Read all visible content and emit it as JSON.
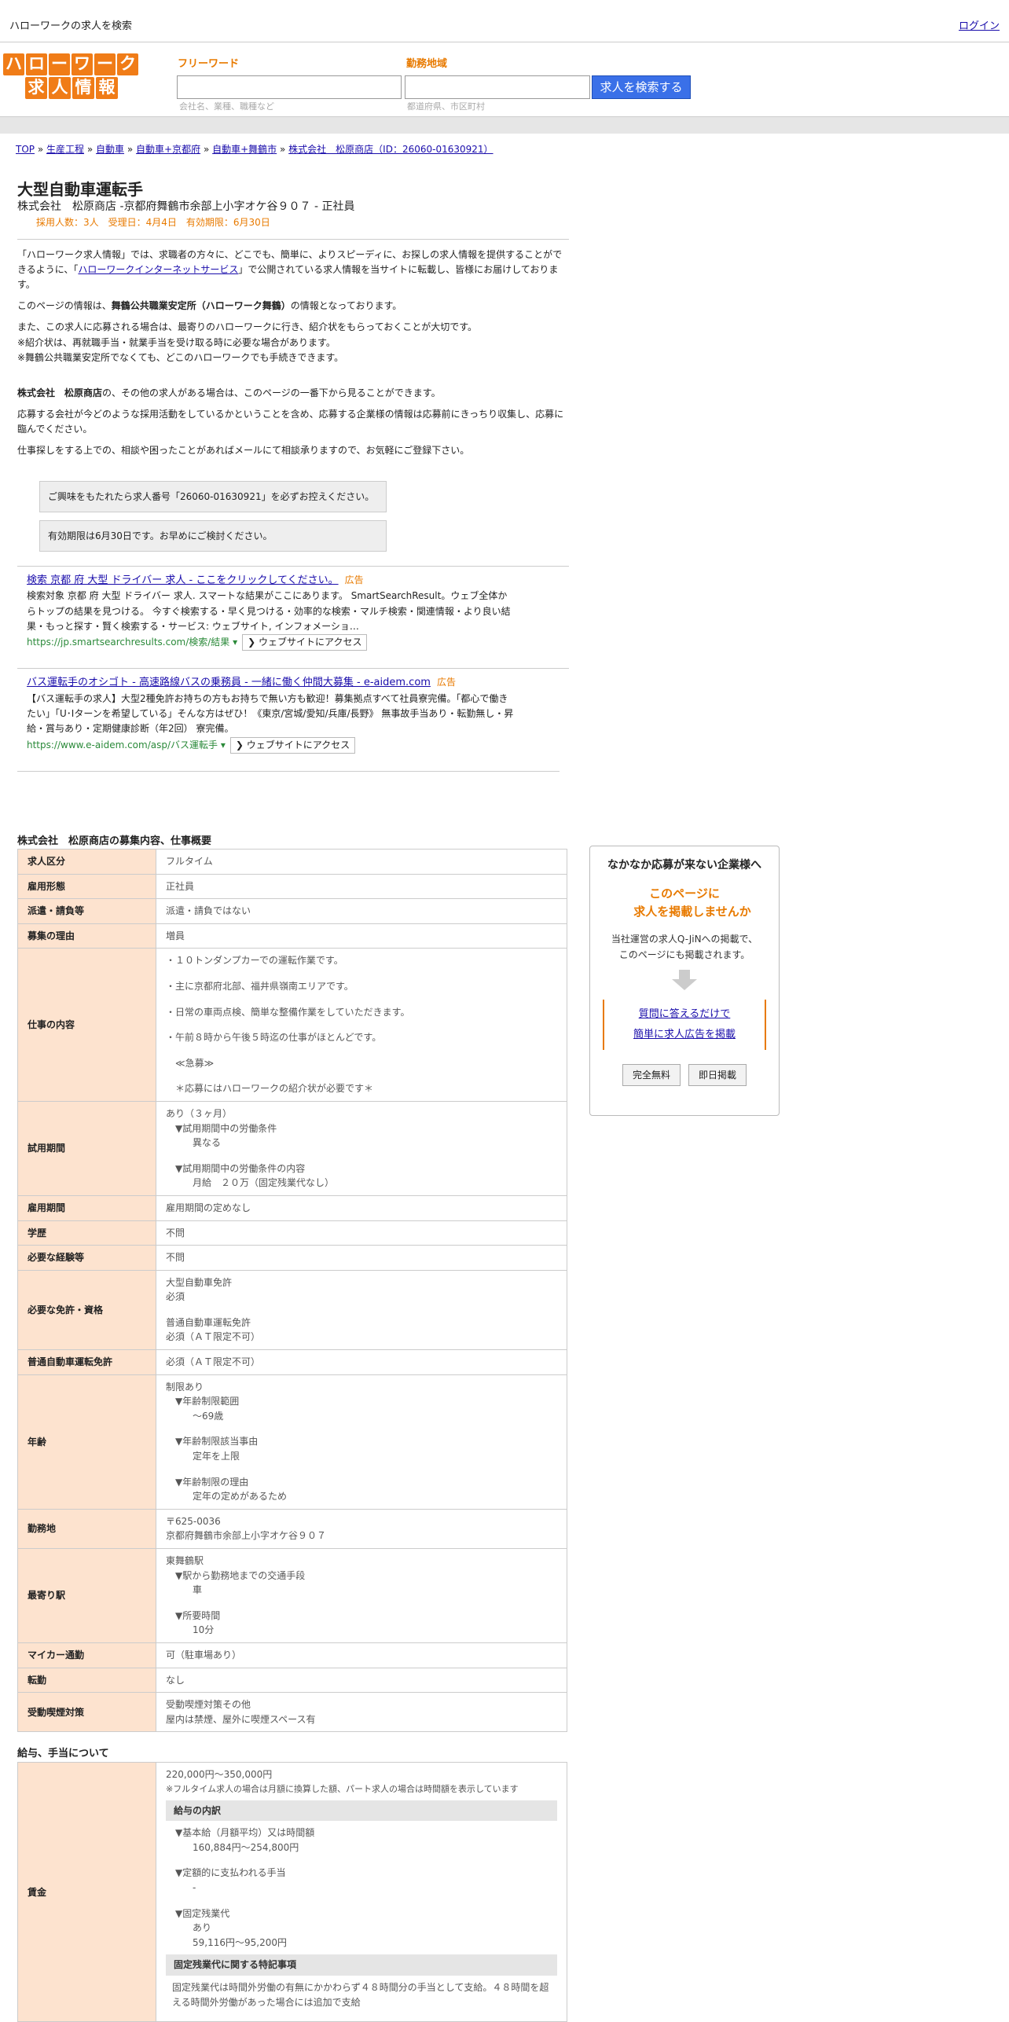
{
  "topbar": {
    "title": "ハローワークの求人を検索",
    "login": "ログイン"
  },
  "logo": {
    "row1": [
      "ハ",
      "ロ",
      "ー",
      "ワ",
      "ー",
      "ク"
    ],
    "row2": [
      "求",
      "人",
      "情",
      "報"
    ]
  },
  "search": {
    "freeword_label": "フリーワード",
    "freeword_hint": "会社名、業種、職種など",
    "area_label": "勤務地域",
    "area_hint": "都道府県、市区町村",
    "button": "求人を検索する"
  },
  "breadcrumb": {
    "items": [
      "TOP",
      "生産工程",
      "自動車",
      "自動車+京都府",
      "自動車+舞鶴市",
      "株式会社　松原商店（ID：26060-01630921）"
    ],
    "sep": "»"
  },
  "job": {
    "title": "大型自動車運転手",
    "subtitle": "株式会社　松原商店 -京都府舞鶴市余部上小字オケ谷９０７ - 正社員",
    "meta": "採用人数：3人　受理日：4月4日　有効期限：6月30日"
  },
  "intro": {
    "p1a": "「ハローワーク求人情報」では、求職者の方々に、どこでも、簡単に、よりスピーディに、お探しの求人情報を提供することができるように、「",
    "p1link": "ハローワークインターネットサービス",
    "p1b": "」で公開されている求人情報を当サイトに転載し、皆様にお届けしております。",
    "p2a": "このページの情報は、",
    "p2b": "舞鶴公共職業安定所（ハローワーク舞鶴）",
    "p2c": "の情報となっております。",
    "p3l1": "また、この求人に応募される場合は、最寄りのハローワークに行き、紹介状をもらっておくことが大切です。",
    "p3l2": "※紹介状は、再就職手当・就業手当を受け取る時に必要な場合があります。",
    "p3l3": "※舞鶴公共職業安定所でなくても、どこのハローワークでも手続きできます。",
    "p4a": "株式会社　松原商店",
    "p4b": "の、その他の求人がある場合は、このページの一番下から見ることができます。",
    "p5": "応募する会社が今どのような採用活動をしているかということを含め、応募する企業様の情報は応募前にきっちり収集し、応募に臨んでください。",
    "p6": "仕事探しをする上での、相談や困ったことがあればメールにて相談承りますので、お気軽にご登録下さい。",
    "notice1": "ご興味をもたれたら求人番号「26060-01630921」を必ずお控えください。",
    "notice2": "有効期限は6月30日です。お早めにご検討ください。"
  },
  "ads": [
    {
      "title": "検索 京都 府 大型 ドライバー 求人 - ここをクリックしてください。",
      "tag": "広告",
      "desc": "検索対象 京都 府 大型 ドライバー 求人. スマートな結果がここにあります。 SmartSearchResult。ウェブ全体からトップの結果を見つける。 今すぐ検索する・早く見つける・効率的な検索・マルチ検索・関連情報・より良い結果・もっと探す・賢く検索する・サービス: ウェブサイト, インフォメーショ…",
      "url": "https://jp.smartsearchresults.com/検索/結果",
      "btn": "❯ ウェブサイトにアクセス"
    },
    {
      "title": "バス運転手のオシゴト - 高速路線バスの乗務員 - 一緒に働く仲間大募集 - e-aidem.com",
      "tag": "広告",
      "desc": "【バス運転手の求人】大型2種免許お持ちの方もお持ちで無い方も歓迎！募集拠点すべて社員寮完備。「都心で働きたい」「U･Iターンを希望している」そんな方はぜひ！《東京/宮城/愛知/兵庫/長野》 無事故手当あり・転勤無し・昇給・賞与あり・定期健康診断（年2回） 寮完備。",
      "url": "https://www.e-aidem.com/asp/バス運転手",
      "btn": "❯ ウェブサイトにアクセス"
    }
  ],
  "section1_title": "株式会社　松原商店の募集内容、仕事概要",
  "table1": [
    {
      "k": "求人区分",
      "v": [
        "フルタイム"
      ]
    },
    {
      "k": "雇用形態",
      "v": [
        "正社員"
      ]
    },
    {
      "k": "派遣・請負等",
      "v": [
        "派遣・請負ではない"
      ]
    },
    {
      "k": "募集の理由",
      "v": [
        "増員"
      ]
    },
    {
      "k": "仕事の内容",
      "v": [
        "・１０トンダンプカーでの運転作業です。",
        "",
        "・主に京都府北部、福井県嶺南エリアです。",
        "",
        "・日常の車両点検、簡単な整備作業をしていただきます。",
        "",
        "・午前８時から午後５時迄の仕事がほとんどです。",
        "",
        "　≪急募≫",
        "",
        "　＊応募にはハローワークの紹介状が必要です＊"
      ]
    },
    {
      "k": "試用期間",
      "v": [
        "あり（３ヶ月）",
        "▼試用期間中の労働条件",
        "　異なる",
        "",
        "▼試用期間中の労働条件の内容",
        "　月給　２０万（固定残業代なし）"
      ]
    },
    {
      "k": "雇用期間",
      "v": [
        "雇用期間の定めなし"
      ]
    },
    {
      "k": "学歴",
      "v": [
        "不問"
      ]
    },
    {
      "k": "必要な経験等",
      "v": [
        "不問"
      ]
    },
    {
      "k": "必要な免許・資格",
      "v": [
        "大型自動車免許",
        "必須",
        "",
        "普通自動車運転免許",
        "必須（ＡＴ限定不可）"
      ]
    },
    {
      "k": "普通自動車運転免許",
      "v": [
        "必須（ＡＴ限定不可）"
      ]
    },
    {
      "k": "年齢",
      "v": [
        "制限あり",
        "▼年齢制限範囲",
        "　〜69歳",
        "",
        "▼年齢制限該当事由",
        "　定年を上限",
        "",
        "▼年齢制限の理由",
        "　定年の定めがあるため"
      ]
    },
    {
      "k": "勤務地",
      "v": [
        "〒625-0036",
        "京都府舞鶴市余部上小字オケ谷９０７"
      ]
    },
    {
      "k": "最寄り駅",
      "v": [
        "東舞鶴駅",
        "▼駅から勤務地までの交通手段",
        "　車",
        "",
        "▼所要時間",
        "　10分"
      ]
    },
    {
      "k": "マイカー通勤",
      "v": [
        "可（駐車場あり）"
      ]
    },
    {
      "k": "転勤",
      "v": [
        "なし"
      ]
    },
    {
      "k": "受動喫煙対策",
      "v": [
        "受動喫煙対策その他",
        "屋内は禁煙、屋外に喫煙スペース有"
      ]
    }
  ],
  "section2_title": "給与、手当について",
  "wage": {
    "k": "賃金",
    "amount": "220,000円〜350,000円",
    "note": "※フルタイム求人の場合は月額に換算した額、パート求人の場合は時間額を表示しています",
    "head1": "給与の内訳",
    "items": [
      "▼基本給（月額平均）又は時間額",
      "　160,884円〜254,800円",
      "",
      "▼定額的に支払われる手当",
      "　-",
      "",
      "▼固定残業代",
      "　あり",
      "　59,116円〜95,200円"
    ],
    "head2": "固定残業代に関する特記事項",
    "special": "固定残業代は時間外労働の有無にかかわらず４８時間分の手当として支給。４８時間を超える時間外労働があった場合には追加で支給"
  },
  "side": {
    "heading": "なかなか応募が来ない企業様へ",
    "offer1": "このページに",
    "offer2": "求人を掲載しませんか",
    "desc1": "当社運営の求人Q-JiNへの掲載で、",
    "desc2": "このページにも掲載されます。",
    "link1": "質問に答えるだけで",
    "link2": "簡単に求人広告を掲載",
    "btn1": "完全無料",
    "btn2": "即日掲載"
  }
}
